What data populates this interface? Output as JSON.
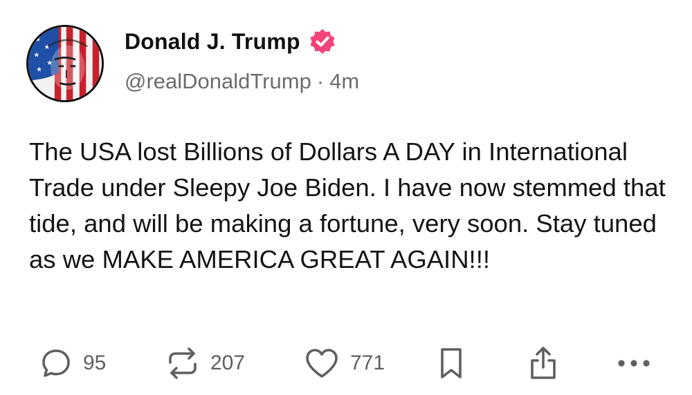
{
  "author": {
    "display_name": "Donald J. Trump",
    "handle": "@realDonaldTrump",
    "verified": true,
    "avatar": "flag-face-avatar"
  },
  "meta": {
    "separator": "·",
    "time_ago": "4m"
  },
  "post": {
    "text": "The USA lost Billions of Dollars A DAY in International Trade under Sleepy Joe Biden. I have now stemmed that tide, and will be making a fortune, very soon. Stay tuned as we MAKE AMERICA GREAT AGAIN!!!"
  },
  "actions": {
    "reply": {
      "icon": "reply-icon",
      "count": "95"
    },
    "retruth": {
      "icon": "retruth-icon",
      "count": "207"
    },
    "like": {
      "icon": "heart-icon",
      "count": "771"
    },
    "bookmark": {
      "icon": "bookmark-icon"
    },
    "share": {
      "icon": "share-icon"
    },
    "more": {
      "icon": "more-icon"
    }
  },
  "colors": {
    "verified_badge": "#f0447a",
    "muted_text": "#6b6b6b",
    "icon": "#5f5f5f"
  }
}
